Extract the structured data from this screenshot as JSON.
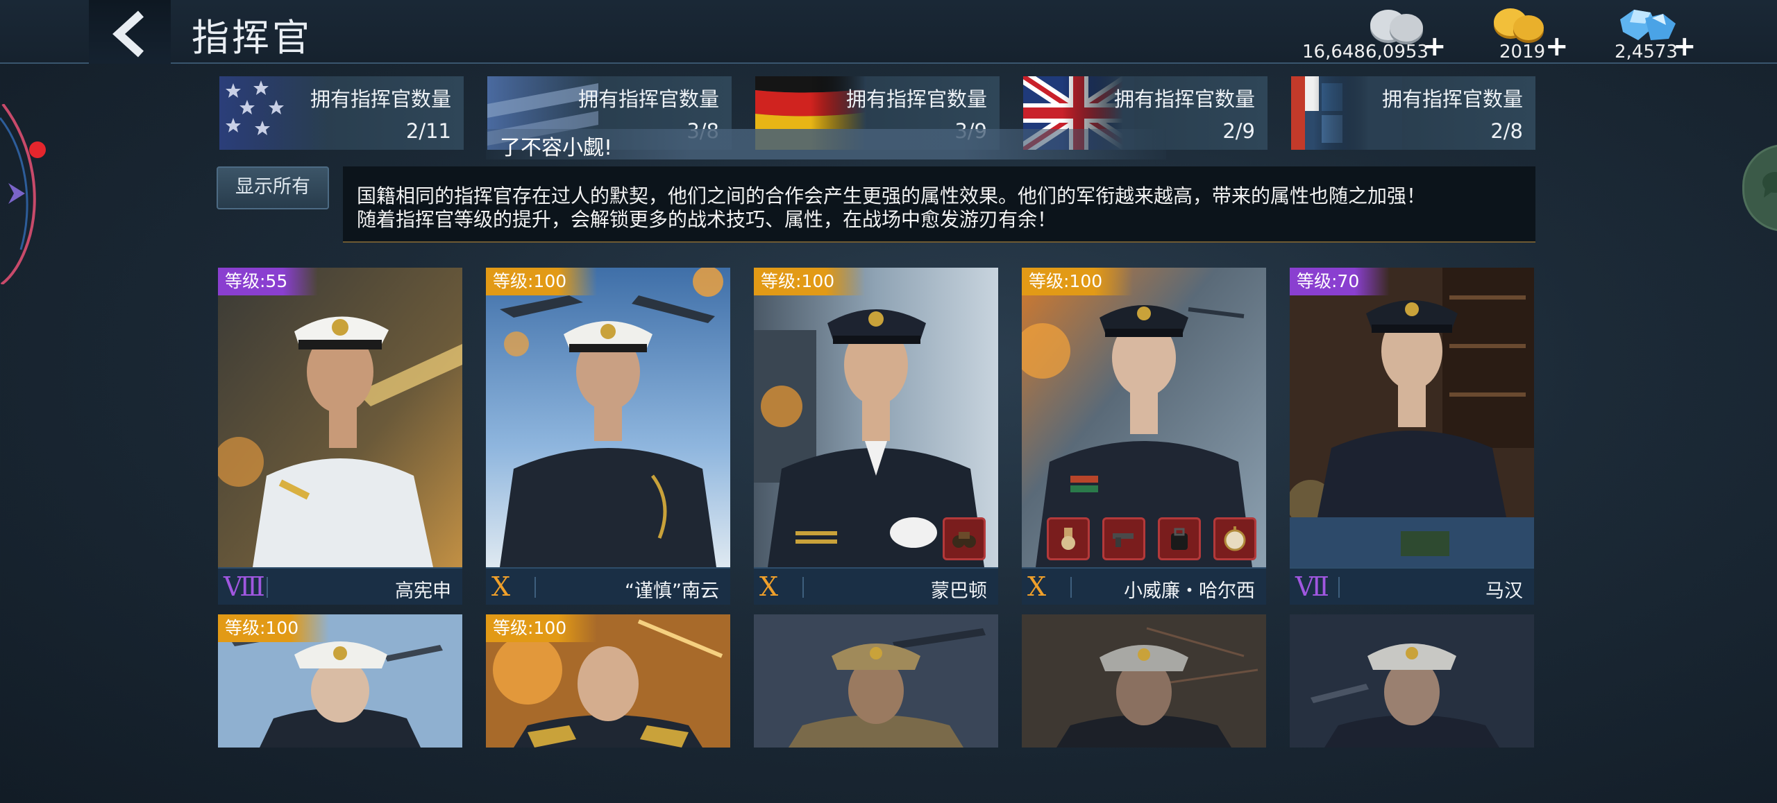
{
  "header": {
    "title": "指挥官",
    "currencies": [
      {
        "icon": "silver-coin-icon",
        "value": "16,6486,0953",
        "plus": "+"
      },
      {
        "icon": "gold-coin-icon",
        "value": "2019",
        "plus": "+"
      },
      {
        "icon": "diamond-icon",
        "value": "2,4573",
        "plus": "+"
      }
    ]
  },
  "nations": [
    {
      "flag": "usa",
      "label": "拥有指挥官数量",
      "count": "2/11"
    },
    {
      "flag": "japan",
      "label": "拥有指挥官数量",
      "count": "3/8"
    },
    {
      "flag": "germany",
      "label": "拥有指挥官数量",
      "count": "3/9"
    },
    {
      "flag": "uk",
      "label": "拥有指挥官数量",
      "count": "2/9"
    },
    {
      "flag": "other",
      "label": "拥有指挥官数量",
      "count": "2/8"
    }
  ],
  "toast": "了不容小觑!",
  "controls": {
    "show_all": "显示所有"
  },
  "description": {
    "line1": "国籍相同的指挥官存在过人的默契，他们之间的合作会产生更强的属性效果。他们的军衔越来越高，带来的属性也随之加强！",
    "line2": "随着指挥官等级的提升，会解锁更多的战术技巧、属性，在战场中愈发游刃有余！"
  },
  "commanders": [
    {
      "level": "等级:55",
      "level_color": "#8a3fd0",
      "rank": "Ⅷ",
      "name": "高宪申",
      "equipment": []
    },
    {
      "level": "等级:100",
      "level_color": "#e29a16",
      "rank": "X",
      "name": "“谨慎”南云",
      "equipment": []
    },
    {
      "level": "等级:100",
      "level_color": "#e29a16",
      "rank": "X",
      "name": "蒙巴顿",
      "equipment": [
        "binoculars-icon"
      ]
    },
    {
      "level": "等级:100",
      "level_color": "#e29a16",
      "rank": "X",
      "name": "小威廉・哈尔西",
      "equipment": [
        "medal-icon",
        "pistol-icon",
        "bag-icon",
        "pocket-watch-icon"
      ]
    },
    {
      "level": "等级:70",
      "level_color": "#8a3fd0",
      "rank": "Ⅶ",
      "name": "马汉",
      "equipment": []
    },
    {
      "level": "等级:100",
      "level_color": "#e29a16"
    },
    {
      "level": "等级:100",
      "level_color": "#e29a16"
    },
    {},
    {},
    {}
  ]
}
